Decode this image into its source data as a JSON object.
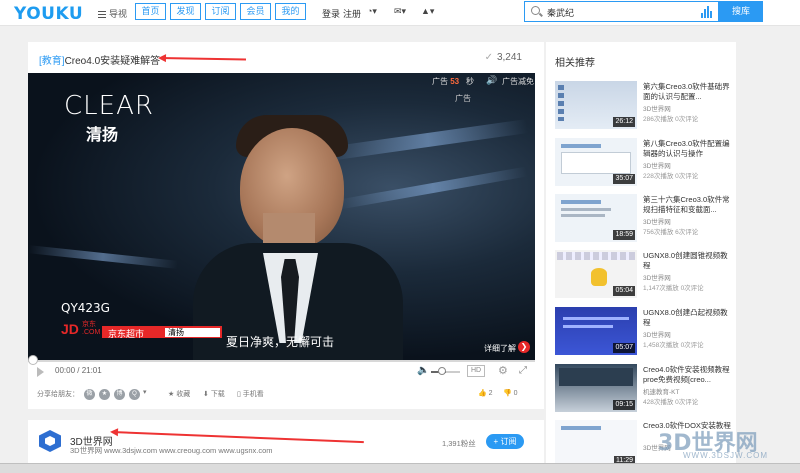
{
  "header": {
    "logo": "YOUKU",
    "guide_label": "导视",
    "tabs": [
      "首页",
      "发现",
      "订阅",
      "会员",
      "我的"
    ],
    "login": "登录",
    "register": "注册",
    "search_value": "秦武纪",
    "search_button": "搜库"
  },
  "video": {
    "category": "[教育]",
    "title": "Creo4.0安装疑难解答",
    "views": "3,241",
    "player": {
      "brand": "CLEAR",
      "brand_cn": "清扬",
      "ad_prefix": "广告",
      "ad_seconds": "53",
      "ad_sec_unit": "秒",
      "ad_reduce": "广告减免",
      "ad_label": "广告",
      "product_code": "QY423G",
      "jd_logo": "JD",
      "jd_small": "京东\n.COM",
      "jd_bar": "京东超市",
      "jd_search": "清扬",
      "subtitle": "夏日净爽，无懈可击",
      "detail": "详细了解",
      "time": "00:00 / 21:01"
    },
    "share_label": "分享给朋友：",
    "actions": {
      "favorite": "收藏",
      "download": "下载",
      "mobile": "手机看",
      "likes": "2",
      "dislikes": "0"
    }
  },
  "uploader": {
    "name": "3D世界网",
    "desc": "3D世界网 www.3dsjw.com www.creoug.com www.ugsnx.com",
    "fans": "1,391粉丝",
    "subscribe": "+ 订阅"
  },
  "sidebar": {
    "title": "相关推荐",
    "items": [
      {
        "title": "第六集Creo3.0软件基础界面的认识与配置...",
        "author": "3D世界网",
        "stats": "286次播放  0次评论",
        "duration": "26:12",
        "style": "desktop"
      },
      {
        "title": "第八集Creo3.0软件配置编辑器的认识与操作",
        "author": "3D世界网",
        "stats": "228次播放  0次评论",
        "duration": "35:07",
        "style": "win"
      },
      {
        "title": "第三十六集Creo3.0软件常规扫描特征和变截面...",
        "author": "3D世界网",
        "stats": "756次播放  6次评论",
        "duration": "18:59",
        "style": "win"
      },
      {
        "title": "UGNX8.0创建圆锥视频教程",
        "author": "3D世界网",
        "stats": "1,147次播放  0次评论",
        "duration": "05:04",
        "style": "yellow"
      },
      {
        "title": "UGNX8.0创建凸起视频教程",
        "author": "3D世界网",
        "stats": "1,458次播放  0次评论",
        "duration": "05:07",
        "style": "blue"
      },
      {
        "title": "Creo4.0软件安装视频教程proe免费视频[creo...",
        "author": "机速教育-KT",
        "stats": "428次播放  0次评论",
        "duration": "09:15",
        "style": "mix"
      },
      {
        "title": "Creo3.0软件DOX安装教程",
        "author": "3D世界网",
        "stats": "",
        "duration": "11:29",
        "style": "doc"
      }
    ]
  },
  "watermark": {
    "text": "3D世界网",
    "url": "WWW.3DSJW.COM"
  },
  "colors": {
    "accent": "#2b9af3",
    "annotation_arrow": "#e33333"
  }
}
